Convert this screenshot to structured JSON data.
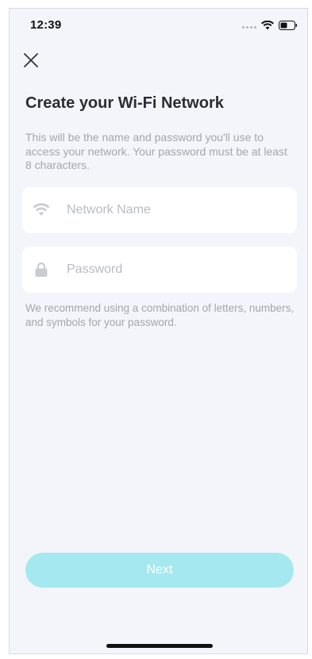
{
  "status_bar": {
    "time": "12:39",
    "wifi_icon": "wifi-icon",
    "battery_icon": "battery-icon"
  },
  "header": {
    "close_icon": "close-icon"
  },
  "main": {
    "title": "Create your Wi-Fi Network",
    "description": "This will be the name and password you'll use to access your network. Your password must be at least 8 characters.",
    "network_name": {
      "icon": "wifi-icon",
      "value": "",
      "placeholder": "Network Name"
    },
    "password": {
      "icon": "lock-icon",
      "value": "",
      "placeholder": "Password"
    },
    "hint": "We recommend using a combination of letters, numbers, and symbols for your password."
  },
  "footer": {
    "next_label": "Next"
  },
  "colors": {
    "background": "#f3f5fa",
    "field_background": "#ffffff",
    "next_button": "#a5e8f0",
    "title_text": "#2a2d33",
    "secondary_text": "#a2a6ad"
  }
}
